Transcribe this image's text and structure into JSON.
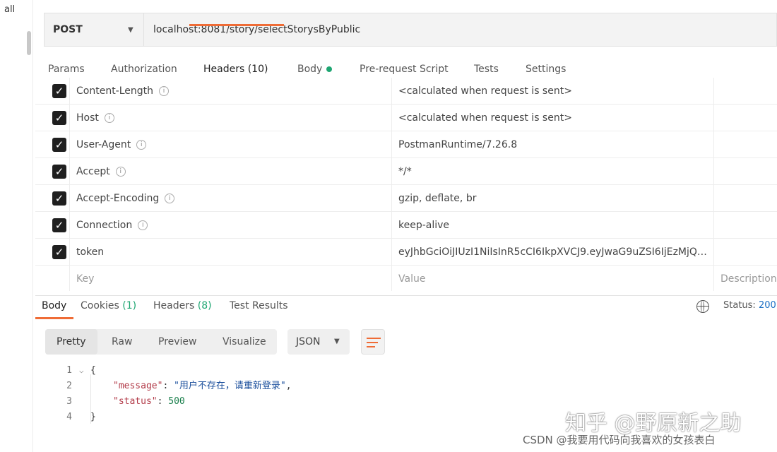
{
  "sidebar": {
    "text": "all"
  },
  "request": {
    "method": "POST",
    "url": "localhost:8081/story/selectStorysByPublic"
  },
  "request_tabs": [
    {
      "label": "Params"
    },
    {
      "label": "Authorization"
    },
    {
      "label": "Headers (10)",
      "active": true
    },
    {
      "label": "Body",
      "has_indicator": true
    },
    {
      "label": "Pre-request Script"
    },
    {
      "label": "Tests"
    },
    {
      "label": "Settings"
    }
  ],
  "headers": [
    {
      "key": "Content-Length",
      "value": "<calculated when request is sent>",
      "checked": true,
      "info": true
    },
    {
      "key": "Host",
      "value": "<calculated when request is sent>",
      "checked": true,
      "info": true
    },
    {
      "key": "User-Agent",
      "value": "PostmanRuntime/7.26.8",
      "checked": true,
      "info": true
    },
    {
      "key": "Accept",
      "value": "*/*",
      "checked": true,
      "info": true
    },
    {
      "key": "Accept-Encoding",
      "value": "gzip, deflate, br",
      "checked": true,
      "info": true
    },
    {
      "key": "Connection",
      "value": "keep-alive",
      "checked": true,
      "info": true
    },
    {
      "key": "token",
      "value": "eyJhbGciOiJIUzI1NiIsInR5cCI6IkpXVCJ9.eyJwaG9uZSI6IjEzMjQ3...",
      "checked": true,
      "info": false
    }
  ],
  "header_placeholders": {
    "key": "Key",
    "value": "Value",
    "description": "Description"
  },
  "response_tabs": [
    {
      "label": "Body",
      "active": true
    },
    {
      "label": "Cookies",
      "count": "(1)"
    },
    {
      "label": "Headers",
      "count": "(8)"
    },
    {
      "label": "Test Results"
    }
  ],
  "status": {
    "label": "Status:",
    "value": "200"
  },
  "view_modes": [
    "Pretty",
    "Raw",
    "Preview",
    "Visualize"
  ],
  "format": {
    "selected": "JSON"
  },
  "code_lines": [
    {
      "num": "1",
      "text": "{"
    },
    {
      "num": "2",
      "key": "\"message\"",
      "value": "\"用户不存在，请重新登录\"",
      "suffix": ","
    },
    {
      "num": "3",
      "key": "\"status\"",
      "value": "500"
    },
    {
      "num": "4",
      "text": "}"
    }
  ],
  "watermark": {
    "line1": "知乎 @野原新之助",
    "line2": "CSDN @我要用代码向我喜欢的女孩表白"
  },
  "colors": {
    "accent": "#ef6c36",
    "green": "#1ea672",
    "status_blue": "#1a6ec4"
  }
}
